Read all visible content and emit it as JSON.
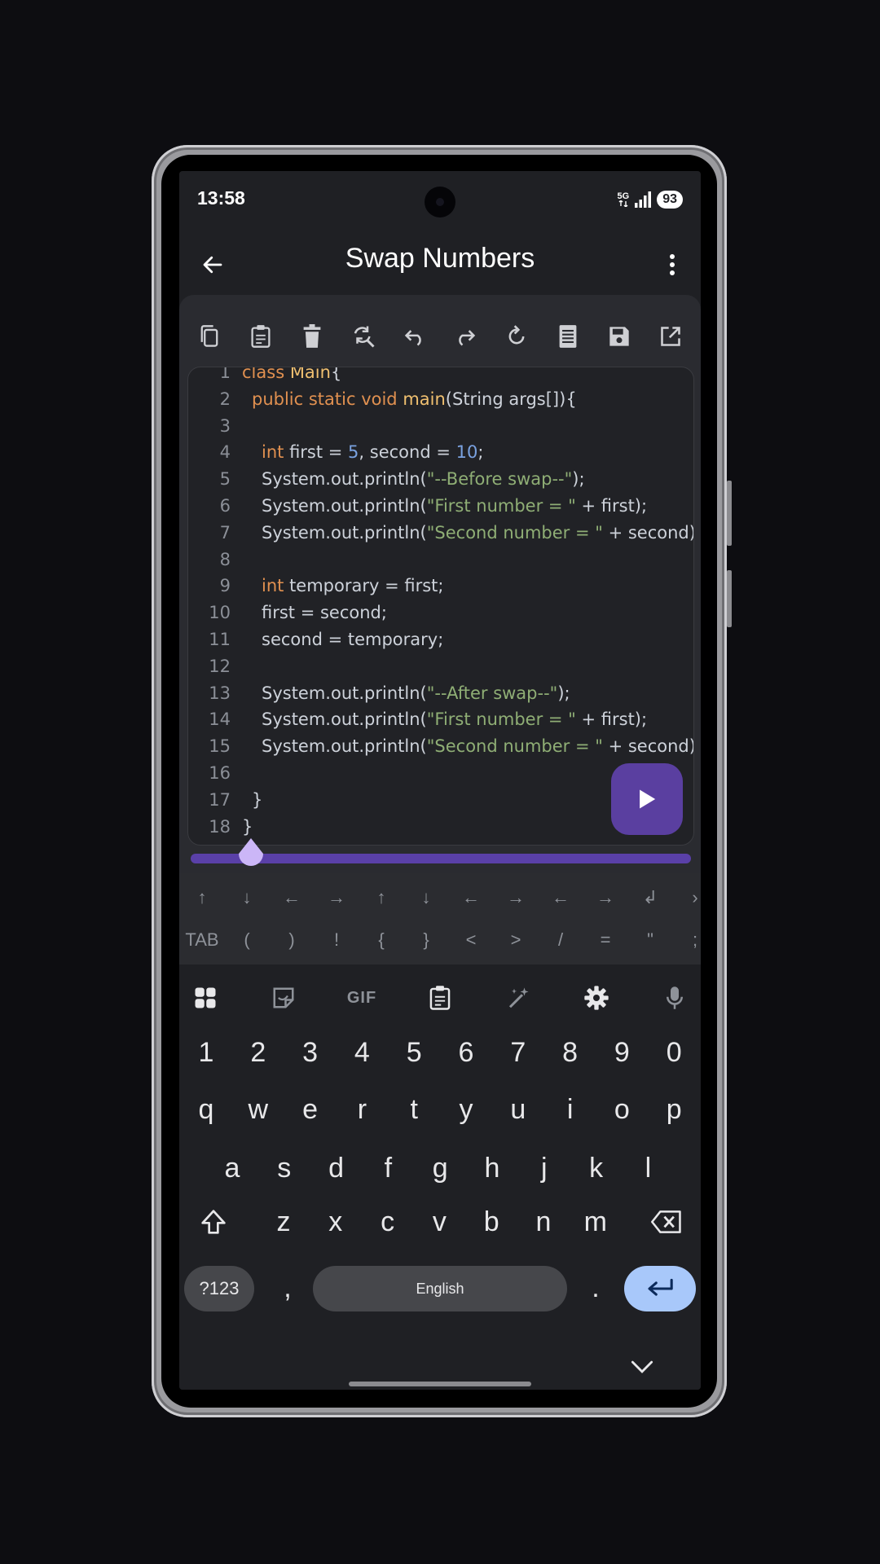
{
  "status": {
    "time": "13:58",
    "network": "5G",
    "battery": "93"
  },
  "appbar": {
    "title": "Swap Numbers"
  },
  "toolbar": [
    "copy-icon",
    "paste-icon",
    "delete-icon",
    "find-replace-icon",
    "undo-icon",
    "redo-icon",
    "refresh-icon",
    "format-icon",
    "save-icon",
    "open-external-icon"
  ],
  "editor": {
    "lines": [
      {
        "n": "1",
        "indent": 0,
        "t": [
          [
            "kw",
            "class "
          ],
          [
            "fn",
            "Main"
          ],
          [
            "",
            "{"
          ]
        ]
      },
      {
        "n": "2",
        "indent": 1,
        "t": [
          [
            "kw",
            "public static void "
          ],
          [
            "fn",
            "main"
          ],
          [
            "",
            "(String args[]){"
          ]
        ]
      },
      {
        "n": "3",
        "indent": 0,
        "t": []
      },
      {
        "n": "4",
        "indent": 2,
        "t": [
          [
            "kw",
            "int "
          ],
          [
            "",
            "first = "
          ],
          [
            "num",
            "5"
          ],
          [
            "",
            ", second = "
          ],
          [
            "num",
            "10"
          ],
          [
            "",
            ";"
          ]
        ]
      },
      {
        "n": "5",
        "indent": 2,
        "t": [
          [
            "",
            "System.out.println("
          ],
          [
            "str",
            "\"--Before swap--\""
          ],
          [
            "",
            ");"
          ]
        ]
      },
      {
        "n": "6",
        "indent": 2,
        "t": [
          [
            "",
            "System.out.println("
          ],
          [
            "str",
            "\"First number = \""
          ],
          [
            "",
            " + first);"
          ]
        ]
      },
      {
        "n": "7",
        "indent": 2,
        "t": [
          [
            "",
            "System.out.println("
          ],
          [
            "str",
            "\"Second number = \""
          ],
          [
            "",
            " + second);"
          ]
        ]
      },
      {
        "n": "8",
        "indent": 0,
        "t": []
      },
      {
        "n": "9",
        "indent": 2,
        "t": [
          [
            "kw",
            "int "
          ],
          [
            "",
            "temporary = first;"
          ]
        ]
      },
      {
        "n": "10",
        "indent": 2,
        "t": [
          [
            "",
            "first = second;"
          ]
        ]
      },
      {
        "n": "11",
        "indent": 2,
        "t": [
          [
            "",
            "second = temporary;"
          ]
        ]
      },
      {
        "n": "12",
        "indent": 0,
        "t": []
      },
      {
        "n": "13",
        "indent": 2,
        "t": [
          [
            "",
            "System.out.println("
          ],
          [
            "str",
            "\"--After swap--\""
          ],
          [
            "",
            ");"
          ]
        ]
      },
      {
        "n": "14",
        "indent": 2,
        "t": [
          [
            "",
            "System.out.println("
          ],
          [
            "str",
            "\"First number = \""
          ],
          [
            "",
            " + first);"
          ]
        ]
      },
      {
        "n": "15",
        "indent": 2,
        "t": [
          [
            "",
            "System.out.println("
          ],
          [
            "str",
            "\"Second number = \""
          ],
          [
            "",
            " + second);"
          ]
        ]
      },
      {
        "n": "16",
        "indent": 0,
        "t": []
      },
      {
        "n": "17",
        "indent": 1,
        "t": [
          [
            "",
            "}"
          ]
        ]
      },
      {
        "n": "18",
        "indent": 0,
        "t": [
          [
            "",
            "}"
          ]
        ]
      }
    ]
  },
  "symbols": {
    "row1": [
      "↑",
      "↓",
      "←",
      "→",
      "↑",
      "↓",
      "←",
      "→",
      "←",
      "→",
      "↲",
      "›"
    ],
    "row2": [
      "TAB",
      "(",
      ")",
      "!",
      "{",
      "}",
      "<",
      ">",
      "/",
      "=",
      "\"",
      ";"
    ]
  },
  "keyboard": {
    "numbers": [
      "1",
      "2",
      "3",
      "4",
      "5",
      "6",
      "7",
      "8",
      "9",
      "0"
    ],
    "row1": [
      "q",
      "w",
      "e",
      "r",
      "t",
      "y",
      "u",
      "i",
      "o",
      "p"
    ],
    "row2": [
      "a",
      "s",
      "d",
      "f",
      "g",
      "h",
      "j",
      "k",
      "l"
    ],
    "row3": [
      "z",
      "x",
      "c",
      "v",
      "b",
      "n",
      "m"
    ],
    "symbols_key": "?123",
    "comma": ",",
    "space_label": "English",
    "period": ".",
    "top_icons": [
      "apps-grid-icon",
      "sticker-icon",
      "gif-icon",
      "clipboard-icon",
      "magic-wand-icon",
      "settings-gear-icon",
      "microphone-icon"
    ],
    "gif_label": "GIF"
  },
  "colors": {
    "accent": "#5a3fa0",
    "enter_key": "#a8c8fa",
    "background": "#1f2024"
  }
}
